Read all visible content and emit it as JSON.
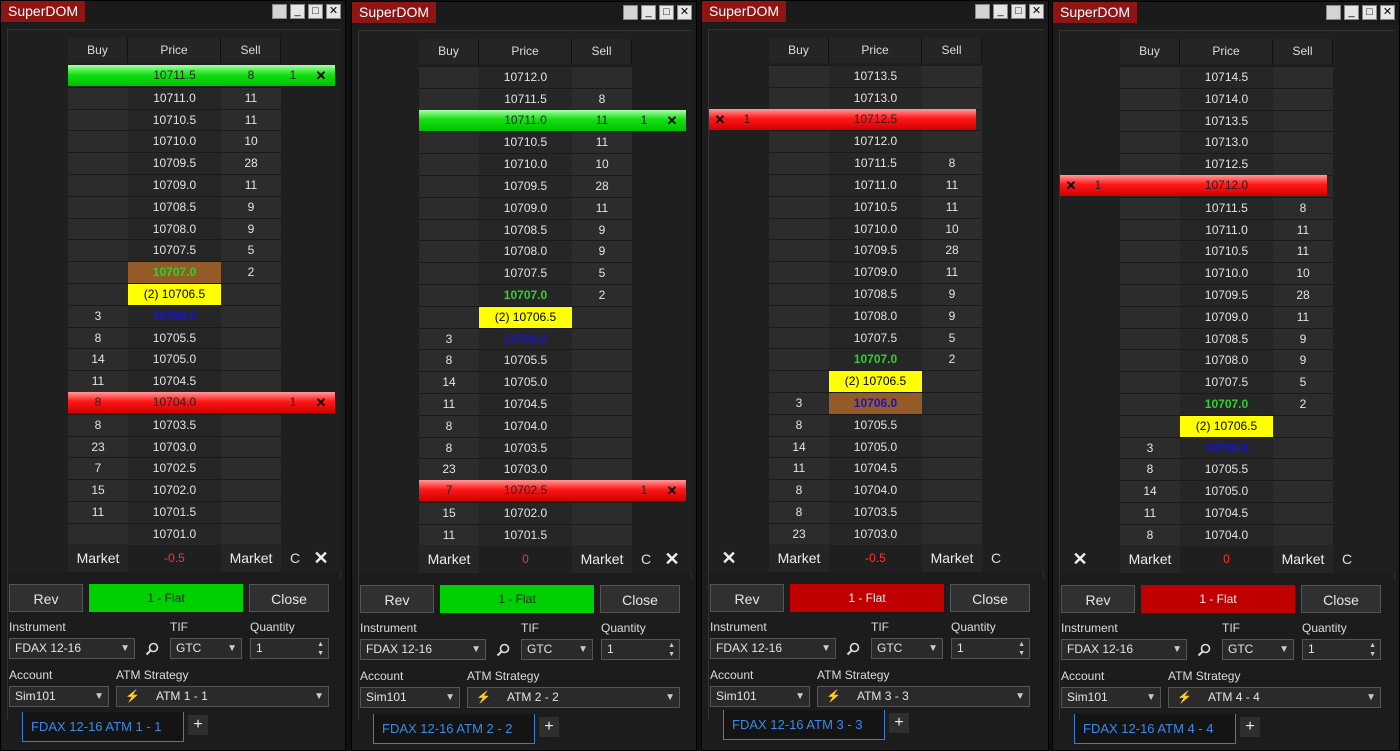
{
  "windows": [
    {
      "title": "SuperDOM",
      "headers": {
        "buy": "Buy",
        "price": "Price",
        "sell": "Sell"
      },
      "rows": [
        {
          "price": "10711.5",
          "buy": "",
          "sell": "8"
        },
        {
          "price": "10711.0",
          "buy": "",
          "sell": "11"
        },
        {
          "price": "10710.5",
          "buy": "",
          "sell": "11"
        },
        {
          "price": "10710.0",
          "buy": "",
          "sell": "10"
        },
        {
          "price": "10709.5",
          "buy": "",
          "sell": "28"
        },
        {
          "price": "10709.0",
          "buy": "",
          "sell": "11"
        },
        {
          "price": "10708.5",
          "buy": "",
          "sell": "9"
        },
        {
          "price": "10708.0",
          "buy": "",
          "sell": "9"
        },
        {
          "price": "10707.5",
          "buy": "",
          "sell": "5"
        },
        {
          "price": "10707.0",
          "buy": "",
          "sell": "2",
          "style": "last-open"
        },
        {
          "price": "(2) 10706.5",
          "buy": "",
          "sell": "",
          "style": "ask"
        },
        {
          "price": "10706.0",
          "buy": "3",
          "sell": "",
          "style": "blue"
        },
        {
          "price": "10705.5",
          "buy": "8",
          "sell": ""
        },
        {
          "price": "10705.0",
          "buy": "14",
          "sell": ""
        },
        {
          "price": "10704.5",
          "buy": "11",
          "sell": ""
        },
        {
          "price": "10704.0",
          "buy": "8",
          "sell": ""
        },
        {
          "price": "10703.5",
          "buy": "8",
          "sell": ""
        },
        {
          "price": "10703.0",
          "buy": "23",
          "sell": ""
        },
        {
          "price": "10702.5",
          "buy": "7",
          "sell": ""
        },
        {
          "price": "10702.0",
          "buy": "15",
          "sell": ""
        },
        {
          "price": "10701.5",
          "buy": "11",
          "sell": ""
        },
        {
          "price": "10701.0",
          "buy": "",
          "sell": ""
        }
      ],
      "orders": [
        {
          "row": 0,
          "color": "green",
          "qty": "1",
          "side": "right"
        },
        {
          "row": 15,
          "color": "red",
          "qty": "1",
          "side": "right"
        }
      ],
      "market_buy": "Market",
      "pnl": "-0.5",
      "market_sell": "Market",
      "c_label": "C",
      "x_side": "right",
      "rev": "Rev",
      "position": "1 - Flat",
      "position_color": "green",
      "close": "Close",
      "instrument_label": "Instrument",
      "instrument": "FDAX 12-16",
      "tif_label": "TIF",
      "tif": "GTC",
      "quantity_label": "Quantity",
      "quantity": "1",
      "account_label": "Account",
      "account": "Sim101",
      "atm_label": "ATM Strategy",
      "atm": "ATM 1 - 1",
      "tab": "FDAX 12-16 ATM 1 - 1"
    },
    {
      "title": "SuperDOM",
      "headers": {
        "buy": "Buy",
        "price": "Price",
        "sell": "Sell"
      },
      "rows": [
        {
          "price": "10712.0",
          "buy": "",
          "sell": ""
        },
        {
          "price": "10711.5",
          "buy": "",
          "sell": "8"
        },
        {
          "price": "10711.0",
          "buy": "",
          "sell": "11"
        },
        {
          "price": "10710.5",
          "buy": "",
          "sell": "11"
        },
        {
          "price": "10710.0",
          "buy": "",
          "sell": "10"
        },
        {
          "price": "10709.5",
          "buy": "",
          "sell": "28"
        },
        {
          "price": "10709.0",
          "buy": "",
          "sell": "11"
        },
        {
          "price": "10708.5",
          "buy": "",
          "sell": "9"
        },
        {
          "price": "10708.0",
          "buy": "",
          "sell": "9"
        },
        {
          "price": "10707.5",
          "buy": "",
          "sell": "5"
        },
        {
          "price": "10707.0",
          "buy": "",
          "sell": "2",
          "style": "last"
        },
        {
          "price": "(2) 10706.5",
          "buy": "",
          "sell": "",
          "style": "ask"
        },
        {
          "price": "10706.0",
          "buy": "3",
          "sell": "",
          "style": "blue"
        },
        {
          "price": "10705.5",
          "buy": "8",
          "sell": ""
        },
        {
          "price": "10705.0",
          "buy": "14",
          "sell": ""
        },
        {
          "price": "10704.5",
          "buy": "11",
          "sell": ""
        },
        {
          "price": "10704.0",
          "buy": "8",
          "sell": ""
        },
        {
          "price": "10703.5",
          "buy": "8",
          "sell": ""
        },
        {
          "price": "10703.0",
          "buy": "23",
          "sell": ""
        },
        {
          "price": "10702.5",
          "buy": "7",
          "sell": ""
        },
        {
          "price": "10702.0",
          "buy": "15",
          "sell": ""
        },
        {
          "price": "10701.5",
          "buy": "11",
          "sell": ""
        }
      ],
      "orders": [
        {
          "row": 2,
          "color": "green",
          "qty": "1",
          "side": "right"
        },
        {
          "row": 19,
          "color": "red",
          "qty": "1",
          "side": "right"
        }
      ],
      "market_buy": "Market",
      "pnl": "0",
      "market_sell": "Market",
      "c_label": "C",
      "x_side": "right",
      "rev": "Rev",
      "position": "1 - Flat",
      "position_color": "green",
      "close": "Close",
      "instrument_label": "Instrument",
      "instrument": "FDAX 12-16",
      "tif_label": "TIF",
      "tif": "GTC",
      "quantity_label": "Quantity",
      "quantity": "1",
      "account_label": "Account",
      "account": "Sim101",
      "atm_label": "ATM Strategy",
      "atm": "ATM 2 - 2",
      "tab": "FDAX 12-16 ATM 2 - 2"
    },
    {
      "title": "SuperDOM",
      "headers": {
        "buy": "Buy",
        "price": "Price",
        "sell": "Sell"
      },
      "rows": [
        {
          "price": "10713.5",
          "buy": "",
          "sell": ""
        },
        {
          "price": "10713.0",
          "buy": "",
          "sell": ""
        },
        {
          "price": "10712.5",
          "buy": "",
          "sell": ""
        },
        {
          "price": "10712.0",
          "buy": "",
          "sell": ""
        },
        {
          "price": "10711.5",
          "buy": "",
          "sell": "8"
        },
        {
          "price": "10711.0",
          "buy": "",
          "sell": "11"
        },
        {
          "price": "10710.5",
          "buy": "",
          "sell": "11"
        },
        {
          "price": "10710.0",
          "buy": "",
          "sell": "10"
        },
        {
          "price": "10709.5",
          "buy": "",
          "sell": "28"
        },
        {
          "price": "10709.0",
          "buy": "",
          "sell": "11"
        },
        {
          "price": "10708.5",
          "buy": "",
          "sell": "9"
        },
        {
          "price": "10708.0",
          "buy": "",
          "sell": "9"
        },
        {
          "price": "10707.5",
          "buy": "",
          "sell": "5"
        },
        {
          "price": "10707.0",
          "buy": "",
          "sell": "2",
          "style": "last"
        },
        {
          "price": "(2) 10706.5",
          "buy": "",
          "sell": "",
          "style": "ask"
        },
        {
          "price": "10706.0",
          "buy": "3",
          "sell": "",
          "style": "blue-open"
        },
        {
          "price": "10705.5",
          "buy": "8",
          "sell": ""
        },
        {
          "price": "10705.0",
          "buy": "14",
          "sell": ""
        },
        {
          "price": "10704.5",
          "buy": "11",
          "sell": ""
        },
        {
          "price": "10704.0",
          "buy": "8",
          "sell": ""
        },
        {
          "price": "10703.5",
          "buy": "8",
          "sell": ""
        },
        {
          "price": "10703.0",
          "buy": "23",
          "sell": ""
        }
      ],
      "orders": [
        {
          "row": 2,
          "color": "red",
          "qty": "1",
          "side": "left"
        }
      ],
      "market_buy": "Market",
      "pnl": "-0.5",
      "market_sell": "Market",
      "c_label": "C",
      "x_side": "left",
      "rev": "Rev",
      "position": "1 - Flat",
      "position_color": "red",
      "close": "Close",
      "instrument_label": "Instrument",
      "instrument": "FDAX 12-16",
      "tif_label": "TIF",
      "tif": "GTC",
      "quantity_label": "Quantity",
      "quantity": "1",
      "account_label": "Account",
      "account": "Sim101",
      "atm_label": "ATM Strategy",
      "atm": "ATM 3 - 3",
      "tab": "FDAX 12-16 ATM 3 - 3"
    },
    {
      "title": "SuperDOM",
      "headers": {
        "buy": "Buy",
        "price": "Price",
        "sell": "Sell"
      },
      "rows": [
        {
          "price": "10714.5",
          "buy": "",
          "sell": ""
        },
        {
          "price": "10714.0",
          "buy": "",
          "sell": ""
        },
        {
          "price": "10713.5",
          "buy": "",
          "sell": ""
        },
        {
          "price": "10713.0",
          "buy": "",
          "sell": ""
        },
        {
          "price": "10712.5",
          "buy": "",
          "sell": ""
        },
        {
          "price": "10712.0",
          "buy": "",
          "sell": ""
        },
        {
          "price": "10711.5",
          "buy": "",
          "sell": "8"
        },
        {
          "price": "10711.0",
          "buy": "",
          "sell": "11"
        },
        {
          "price": "10710.5",
          "buy": "",
          "sell": "11"
        },
        {
          "price": "10710.0",
          "buy": "",
          "sell": "10"
        },
        {
          "price": "10709.5",
          "buy": "",
          "sell": "28"
        },
        {
          "price": "10709.0",
          "buy": "",
          "sell": "11"
        },
        {
          "price": "10708.5",
          "buy": "",
          "sell": "9"
        },
        {
          "price": "10708.0",
          "buy": "",
          "sell": "9"
        },
        {
          "price": "10707.5",
          "buy": "",
          "sell": "5"
        },
        {
          "price": "10707.0",
          "buy": "",
          "sell": "2",
          "style": "last"
        },
        {
          "price": "(2) 10706.5",
          "buy": "",
          "sell": "",
          "style": "ask"
        },
        {
          "price": "10706.0",
          "buy": "3",
          "sell": "",
          "style": "blue"
        },
        {
          "price": "10705.5",
          "buy": "8",
          "sell": ""
        },
        {
          "price": "10705.0",
          "buy": "14",
          "sell": ""
        },
        {
          "price": "10704.5",
          "buy": "11",
          "sell": ""
        },
        {
          "price": "10704.0",
          "buy": "8",
          "sell": ""
        }
      ],
      "orders": [
        {
          "row": 5,
          "color": "red",
          "qty": "1",
          "side": "left"
        }
      ],
      "market_buy": "Market",
      "pnl": "0",
      "market_sell": "Market",
      "c_label": "C",
      "x_side": "left",
      "rev": "Rev",
      "position": "1 - Flat",
      "position_color": "red",
      "close": "Close",
      "instrument_label": "Instrument",
      "instrument": "FDAX 12-16",
      "tif_label": "TIF",
      "tif": "GTC",
      "quantity_label": "Quantity",
      "quantity": "1",
      "account_label": "Account",
      "account": "Sim101",
      "atm_label": "ATM Strategy",
      "atm": "ATM 4 - 4",
      "tab": "FDAX 12-16 ATM 4 - 4"
    }
  ],
  "icons": {
    "close": "close-icon",
    "minimize": "minimize-icon",
    "maximize": "maximize-icon",
    "restore": "restore-icon",
    "search": "search-icon",
    "lightning": "lightning-icon",
    "add": "add-tab-icon"
  },
  "colors": {
    "title_bg": "#8f1515",
    "order_green": "#00d000",
    "order_red": "#e00000",
    "ask_yellow": "#ffff00",
    "last_green": "#30d030",
    "bid_blue": "#1515d0",
    "tab_blue": "#3a8ae8"
  }
}
